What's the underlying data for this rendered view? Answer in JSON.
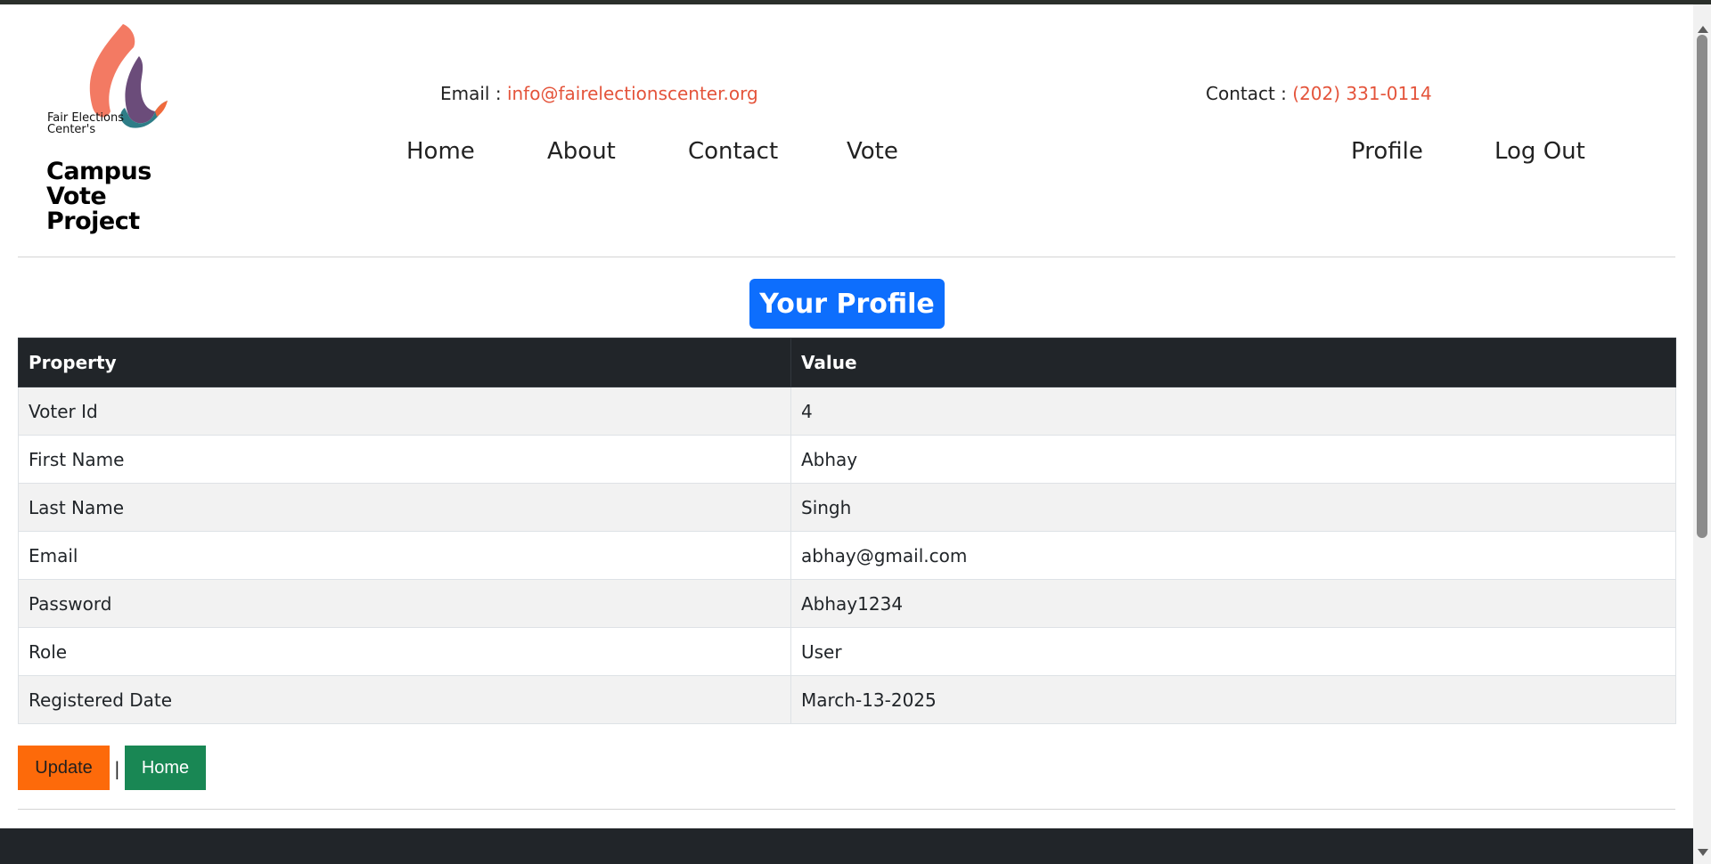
{
  "header": {
    "logo": {
      "org_text": "Fair Elections Center's",
      "brand_line1": "Campus",
      "brand_line2": "Vote",
      "brand_line3": "Project",
      "colors": {
        "flame_coral": "#f37a63",
        "flame_purple": "#6b4c7a",
        "flame_teal": "#2e7d87",
        "flame_orange": "#f06a3c"
      }
    },
    "email_label": "Email :",
    "email_value": "info@fairelectionscenter.org",
    "contact_label": "Contact :",
    "contact_value": "(202) 331-0114",
    "nav": {
      "home": "Home",
      "about": "About",
      "contact": "Contact",
      "vote": "Vote",
      "profile": "Profile",
      "logout": "Log Out"
    }
  },
  "main": {
    "title": "Your Profile",
    "table": {
      "headers": {
        "property": "Property",
        "value": "Value"
      },
      "rows": [
        {
          "property": "Voter Id",
          "value": "4"
        },
        {
          "property": "First Name",
          "value": "Abhay"
        },
        {
          "property": "Last Name",
          "value": "Singh"
        },
        {
          "property": "Email",
          "value": "abhay@gmail.com"
        },
        {
          "property": "Password",
          "value": "Abhay1234"
        },
        {
          "property": "Role",
          "value": "User"
        },
        {
          "property": "Registered Date",
          "value": "March-13-2025"
        }
      ]
    },
    "actions": {
      "update_label": "Update",
      "separator": "|",
      "home_label": "Home"
    }
  },
  "colors": {
    "accent_link": "#e4543b",
    "title_blue": "#0d6efd",
    "update_orange": "#fd6a0a",
    "home_green": "#198754",
    "table_header": "#212529"
  }
}
